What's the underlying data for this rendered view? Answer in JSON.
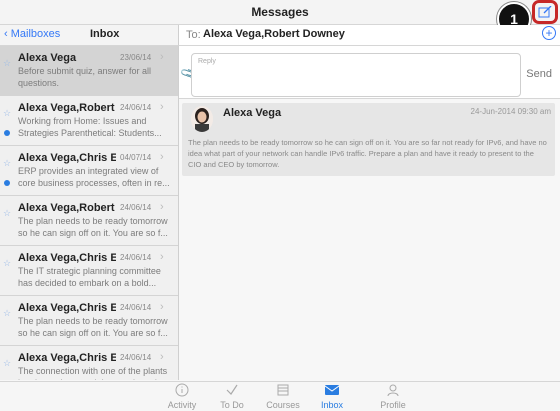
{
  "header": {
    "title": "Messages",
    "callout": "1"
  },
  "leftnav": {
    "back_label": "Mailboxes",
    "title": "Inbox"
  },
  "compose": {
    "to_label": "To:",
    "to_value": "Alexa Vega,Robert Downey",
    "reply_placeholder": "Reply",
    "send_label": "Send"
  },
  "messages": [
    {
      "from": "Alexa Vega",
      "date": "23/06/14",
      "snippet": "Before submit quiz, answer for all questions.",
      "unread": false,
      "selected": true
    },
    {
      "from": "Alexa Vega,Robert ...",
      "date": "24/06/14",
      "snippet": "Working from Home: Issues and Strategies Parenthetical: Students...",
      "unread": true,
      "selected": false
    },
    {
      "from": "Alexa Vega,Chris Ev...",
      "date": "04/07/14",
      "snippet": "ERP provides an integrated view of core business processes, often in re...",
      "unread": true,
      "selected": false
    },
    {
      "from": "Alexa Vega,Robert ...",
      "date": "24/06/14",
      "snippet": "The plan needs to be ready tomorrow so he can sign off on it. You are so f...",
      "unread": false,
      "selected": false
    },
    {
      "from": "Alexa Vega,Chris Ev...",
      "date": "24/06/14",
      "snippet": "The IT strategic planning committee has decided to embark on a bold...",
      "unread": false,
      "selected": false
    },
    {
      "from": "Alexa Vega,Chris Ev...",
      "date": "24/06/14",
      "snippet": "The plan needs to be ready tomorrow so he can sign off on it. You are so f...",
      "unread": false,
      "selected": false
    },
    {
      "from": "Alexa Vega,Chris Ev...",
      "date": "24/06/14",
      "snippet": "The connection with one of the plants has been down and they can't get it...",
      "unread": false,
      "selected": false
    }
  ],
  "detail": {
    "sender": "Alexa Vega",
    "date": "24-Jun-2014 09:30 am",
    "body": "The plan needs to be ready tomorrow so he can sign off on it. You are so far not ready for IPv6, and have no idea what part of your network can handle IPv6 traffic. Prepare a plan and have it ready to present to the CIO and CEO by tomorrow."
  },
  "tabs": [
    {
      "label": "Activity",
      "icon": "activity-icon",
      "active": false
    },
    {
      "label": "To Do",
      "icon": "todo-icon",
      "active": false
    },
    {
      "label": "Courses",
      "icon": "courses-icon",
      "active": false
    },
    {
      "label": "Inbox",
      "icon": "inbox-icon",
      "active": true
    },
    {
      "label": "Profile",
      "icon": "profile-icon",
      "active": false
    }
  ],
  "colors": {
    "accent": "#2a7de1",
    "highlight": "#c62828"
  }
}
